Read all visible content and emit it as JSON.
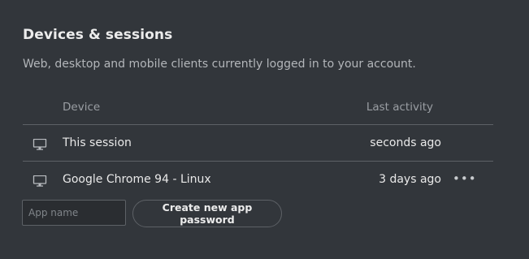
{
  "section": {
    "title": "Devices & sessions",
    "subtitle": "Web, desktop and mobile clients currently logged in to your account."
  },
  "table": {
    "columns": {
      "device": "Device",
      "last_activity": "Last activity"
    },
    "rows": [
      {
        "icon": "desktop-icon",
        "device": "This session",
        "last_activity": "seconds ago",
        "has_menu": false
      },
      {
        "icon": "desktop-icon",
        "device": "Google Chrome 94 - Linux",
        "last_activity": "3 days ago",
        "has_menu": true,
        "menu_glyph": "•••"
      }
    ]
  },
  "app_password": {
    "input_value": "",
    "input_placeholder": "App name",
    "button_label": "Create new app password"
  },
  "colors": {
    "background": "#32363b",
    "divider": "#5d6166",
    "text_primary": "#e9e9e9",
    "text_secondary": "#b3b6ba",
    "text_muted": "#9a9ea3"
  }
}
